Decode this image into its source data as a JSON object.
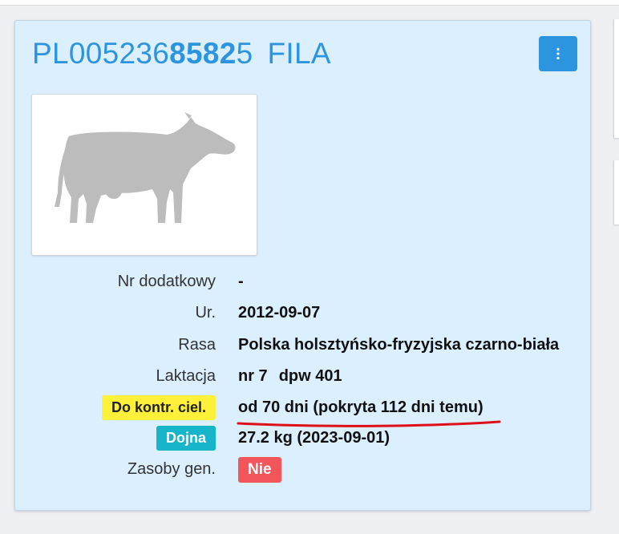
{
  "animal": {
    "id_prefix": "PL005236",
    "id_bold": "8582",
    "id_suffix": "5",
    "name": "FILA"
  },
  "menu_icon": "vertical-dots-icon",
  "photo_icon": "cow-silhouette-icon",
  "details": {
    "nr_dodatkowy": {
      "label": "Nr dodatkowy",
      "value": "-"
    },
    "ur": {
      "label": "Ur.",
      "value": "2012-09-07"
    },
    "rasa": {
      "label": "Rasa",
      "value": "Polska holsztyńsko-fryzyjska czarno-biała"
    },
    "laktacja": {
      "label": "Laktacja",
      "nr": "nr 7",
      "dpw": "dpw 401"
    },
    "kontrola": {
      "label": "Do kontr. ciel.",
      "value": "od 70 dni (pokryta 112 dni temu)"
    },
    "dojna": {
      "label": "Dojna",
      "value": "27.2 kg (2023-09-01)"
    },
    "zasoby": {
      "label": "Zasoby gen.",
      "value": "Nie"
    }
  },
  "colors": {
    "accent": "#2d95e0",
    "card_bg": "#dcefff",
    "badge_yellow": "#fff03a",
    "badge_teal": "#17b5c9",
    "badge_red": "#f2555a",
    "annotation_red": "#e0101a"
  }
}
